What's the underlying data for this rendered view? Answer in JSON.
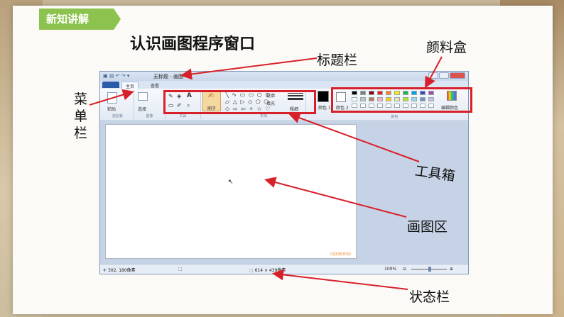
{
  "badge": "新知讲解",
  "page_title": "认识画图程序窗口",
  "labels": {
    "title_bar": "标题栏",
    "palette": "颜料盒",
    "menu_bar": "菜单栏",
    "toolbox": "工具箱",
    "canvas": "画图区",
    "status_bar": "状态栏"
  },
  "window": {
    "title": "无标题 - 画图",
    "tabs": [
      "主页",
      "查看"
    ],
    "groups": [
      "剪贴板",
      "图像",
      "工具",
      "形状",
      "颜色"
    ],
    "clipboard_paste": "粘贴",
    "image_select": "选择",
    "brush": "刷子",
    "outline": "轮廓",
    "fill": "填充",
    "size": "粗细",
    "color1": "颜色 1",
    "color2": "颜色 2",
    "edit_colors": "编辑颜色",
    "watermark": "《易知教育网》",
    "status": {
      "cursor_pos": "302, 180像素",
      "image_size": "614 × 439像素",
      "zoom": "100%"
    }
  },
  "colors": {
    "highlight": "#d8202a",
    "badge": "#8cc34f",
    "palette_row1": [
      "#000000",
      "#7f7f7f",
      "#880015",
      "#ed1c24",
      "#ff7f27",
      "#fff200",
      "#22b14c",
      "#00a2e8",
      "#3f48cc",
      "#a349a4"
    ],
    "palette_row2": [
      "#ffffff",
      "#c3c3c3",
      "#b97a57",
      "#ffaec9",
      "#ffc90e",
      "#efe4b0",
      "#b5e61d",
      "#99d9ea",
      "#7092be",
      "#c8bfe7"
    ]
  }
}
